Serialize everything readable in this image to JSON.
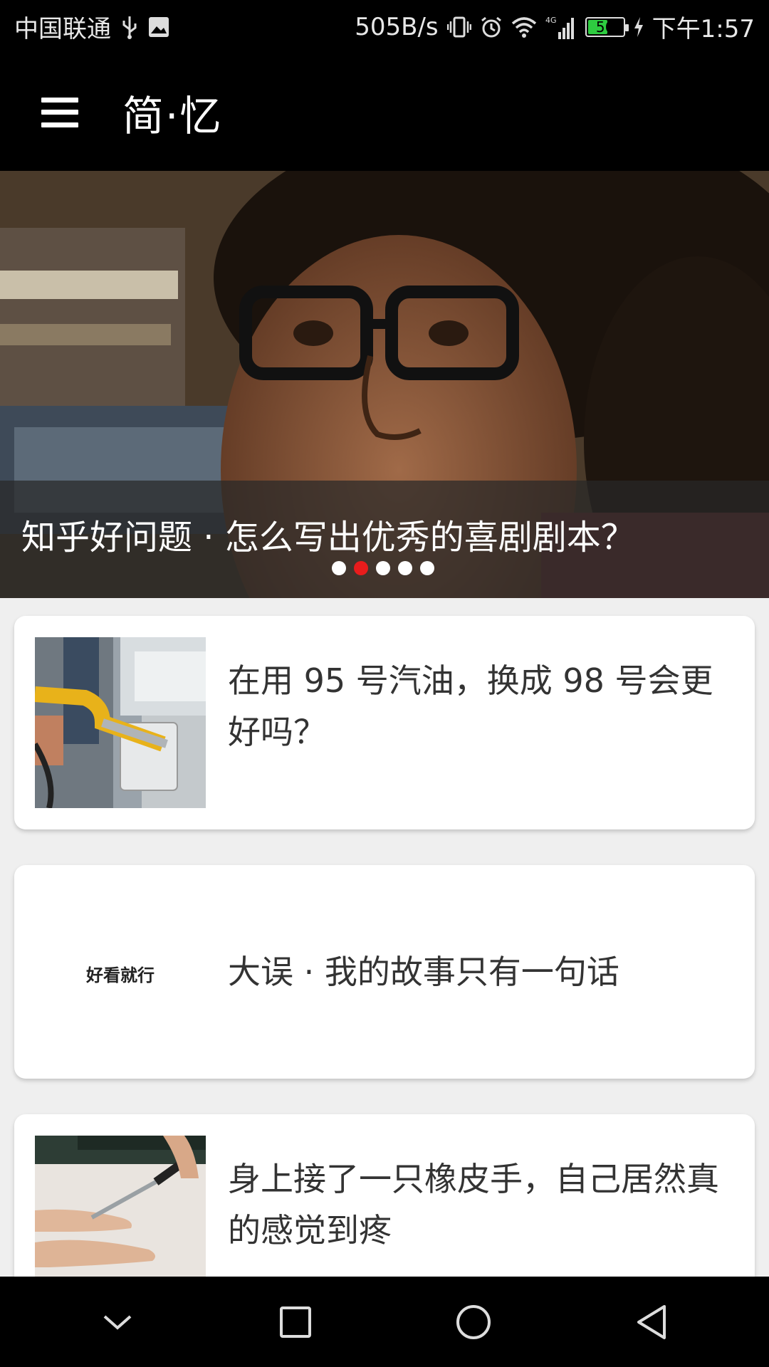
{
  "status_bar": {
    "carrier": "中国联通",
    "net_speed": "505B/s",
    "network_type": "4G",
    "battery_level": "56",
    "time": "下午1:57"
  },
  "app_bar": {
    "title": "简·忆"
  },
  "banner": {
    "title": "知乎好问题 · 怎么写出优秀的喜剧剧本？",
    "page_count": 5,
    "active_page": 2
  },
  "feed": [
    {
      "title": "在用 95 号汽油，换成 98 号会更好吗？",
      "thumbnail": "fuel-nozzle-photo"
    },
    {
      "title": "大误 · 我的故事只有一句话",
      "thumbnail": "logo-text",
      "thumbnail_text": "好看就行"
    },
    {
      "title": "身上接了一只橡皮手，自己居然真的感觉到疼",
      "thumbnail": "knife-hands-photo"
    }
  ],
  "colors": {
    "bar_background": "#000000",
    "page_background": "#efefef",
    "active_dot": "#e81c1c",
    "battery_fill": "#2ecc40"
  }
}
